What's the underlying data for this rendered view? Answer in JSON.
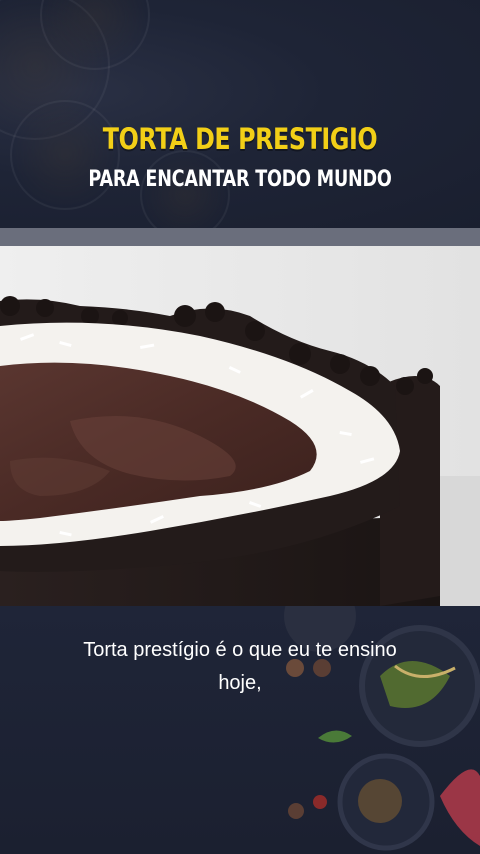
{
  "banner": {
    "title": "TORTA DE PRESTIGIO",
    "subtitle": "PARA ENCANTAR TODO MUNDO"
  },
  "video": {
    "subject": "chocolate-coconut-tart",
    "colors": {
      "background": "#e8e8e8",
      "crust": "#231b1a",
      "chocolate": "#4a2b26",
      "coconut": "#f4f2ee"
    }
  },
  "caption": {
    "line1": "Torta prestígio é o que eu te ensino",
    "line2": "hoje,"
  },
  "colors": {
    "title_yellow": "#f2cf17",
    "subtitle_white": "#ffffff",
    "panel_navy": "#1d2335"
  }
}
